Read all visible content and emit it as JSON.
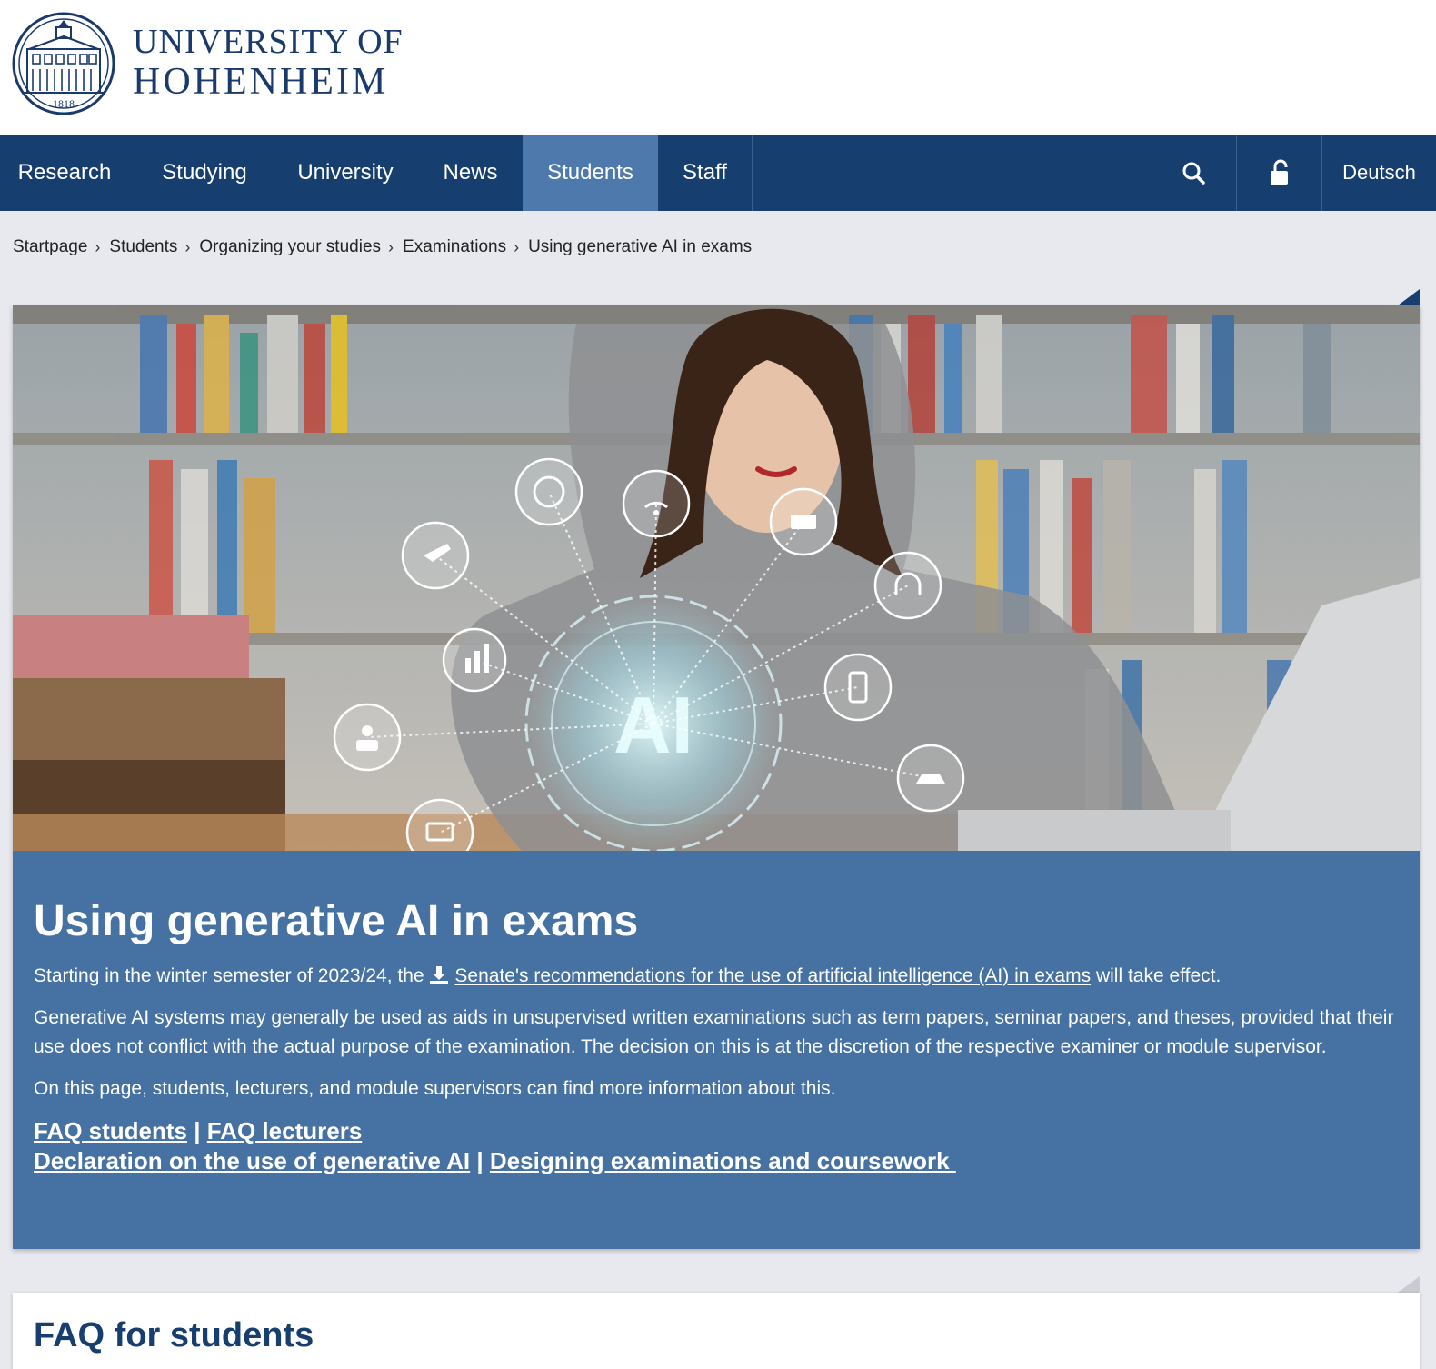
{
  "brand": {
    "line1": "UNIVERSITY OF",
    "line2": "HOHENHEIM",
    "seal_year": "1818"
  },
  "nav": {
    "items": [
      {
        "label": "Research",
        "active": false
      },
      {
        "label": "Studying",
        "active": false
      },
      {
        "label": "University",
        "active": false
      },
      {
        "label": "News",
        "active": false
      },
      {
        "label": "Students",
        "active": true
      },
      {
        "label": "Staff",
        "active": false
      }
    ],
    "search_icon": "search-icon",
    "login_icon": "unlock-icon",
    "language": "Deutsch"
  },
  "breadcrumb": [
    "Startpage",
    "Students",
    "Organizing your studies",
    "Examinations",
    "Using generative AI in exams"
  ],
  "hero": {
    "title": "Using generative AI in exams",
    "intro_before": "Starting in the winter semester of 2023/24, the",
    "intro_link": "Senate's recommendations for the use of artificial intelligence (AI) in exams",
    "intro_after": "will take effect.",
    "paragraph2": "Generative AI systems may generally be used as aids in unsupervised written examinations such as term papers, seminar papers, and theses, provided that their use does not conflict with the actual purpose of the examination. The decision on this is at the discretion of the respective examiner or module supervisor.",
    "paragraph3": "On this page, students, lecturers, and module supervisors can find more information about this.",
    "links_row1": [
      "FAQ students",
      "FAQ lecturers"
    ],
    "links_row2": [
      "Declaration on the use of generative AI",
      "Designing examinations and coursework "
    ],
    "separator": "|",
    "image_text": "AI"
  },
  "faq": {
    "title": "FAQ for students"
  },
  "colors": {
    "nav_bg": "#163e6f",
    "nav_active": "#4e79ad",
    "hero_bg": "#4571a3",
    "page_bg": "#e8e9ee",
    "brand": "#1a3a6b"
  }
}
